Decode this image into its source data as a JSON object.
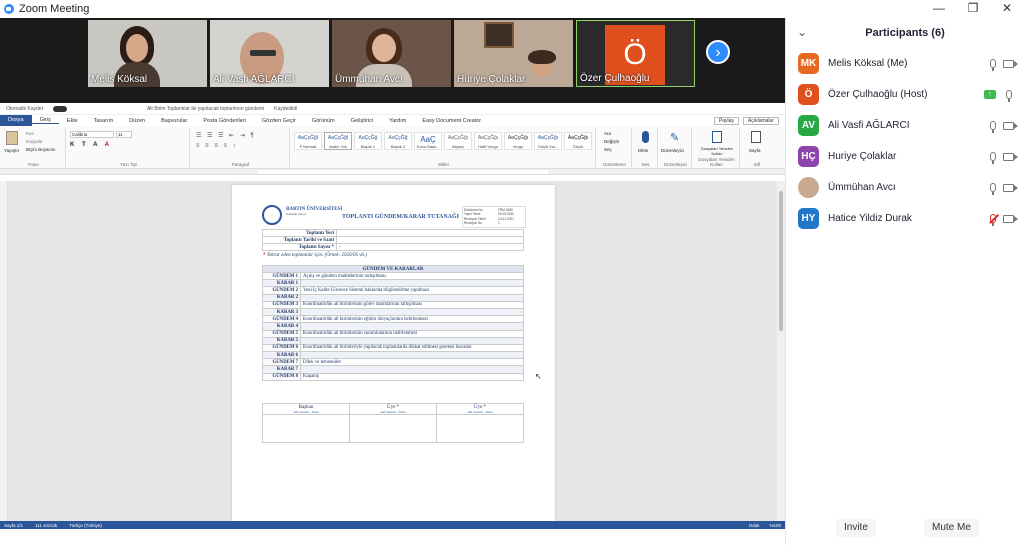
{
  "window": {
    "title": "Zoom Meeting",
    "controls": [
      "—",
      "❐",
      "✕"
    ]
  },
  "gallery": {
    "tiles": [
      {
        "name": "Melis Köksal"
      },
      {
        "name": "Ali Vasfi AĞLARCI"
      },
      {
        "name": "Ümmühan Avcı"
      },
      {
        "name": "Huriye Çolaklar"
      },
      {
        "name": "Özer Çulhaoğlu",
        "avatar_letter": "Ö",
        "avatar_color": "#e0501f"
      }
    ],
    "next_arrow": "›"
  },
  "word": {
    "titlebar": {
      "autosave": "Otomatik Kaydet",
      "filename": "Alt Birim Toplantılar ile yapılacak toplantının gündemi",
      "status": "Kaydedildi"
    },
    "menu": {
      "file": "Dosya",
      "tabs": [
        "Giriş",
        "Ekle",
        "Tasarım",
        "Düzen",
        "Başvurular",
        "Posta Gönderileri",
        "Gözden Geçir",
        "Görünüm",
        "Geliştirici",
        "Yardım",
        "Easy Document Creator"
      ],
      "share": "Paylaş",
      "comments": "Açıklamalar"
    },
    "ribbon": {
      "paste": "Yapıştır",
      "cut": "Kes",
      "copy": "Kopyala",
      "painter": "Biçim Boyacısı",
      "font": "Calibria",
      "size": "11",
      "styles": [
        {
          "sample": "AaÇçĞğI",
          "name": "¶ Normal"
        },
        {
          "sample": "AaÇçĞğI",
          "name": "Aralık Yok"
        },
        {
          "sample": "AaÇçĞğ",
          "name": "Başlık 1"
        },
        {
          "sample": "AaÇçĞğ",
          "name": "Başlık 2"
        },
        {
          "sample": "AaÇ",
          "name": "Konu Başlı..."
        },
        {
          "sample": "AaÇçĞğı",
          "name": "Altyazı"
        },
        {
          "sample": "AaÇçĞğı",
          "name": "Hafif Vurgu"
        },
        {
          "sample": "AaÇçĞğı",
          "name": "Vurgu"
        },
        {
          "sample": "AaÇçĞğı",
          "name": "Güçlü Vur..."
        },
        {
          "sample": "AaÇçĞğı",
          "name": "Güçlü"
        }
      ],
      "find": "Ara",
      "replace": "Değiştir",
      "select": "Seç",
      "dictate": "Dikte",
      "editor": "Düzenleyici",
      "reuse": "Dosyaları Yeniden Kullan",
      "page": "Sayfa",
      "groups": [
        "Pano",
        "Yazı Tipi",
        "Paragraf",
        "Stiller",
        "Düzenleme",
        "Ses",
        "Düzenleyici",
        "Dosyaları Yeniden Kullan",
        "Sıfl"
      ]
    },
    "doc": {
      "university": "BARTIN ÜNİVERSİTESİ",
      "university_sub": "Kalitenin Adresi",
      "title": "TOPLANTI GÜNDEM/KARAR TUTANAĞI",
      "meta": [
        [
          "Doküman No",
          "FRM-0630"
        ],
        [
          "Yayın Tarihi",
          "24.09.2020"
        ],
        [
          "Revizyon Tarihi",
          "13.01.2021"
        ],
        [
          "Revizyon No",
          "1"
        ]
      ],
      "fields": [
        {
          "label": "Toplantı Yeri",
          "value": ""
        },
        {
          "label": "Toplantı Tarihi ve Saati",
          "value": ""
        },
        {
          "label": "Toplantı Sayısı *",
          "value": "-"
        }
      ],
      "note_star": "*",
      "note": "Tekrar eden toplantılar için. (Örnek: 2020/05 vb.)",
      "agenda_header": "GÜNDEM VE KARARLAR",
      "rows": [
        {
          "k": "GÜNDEM 1",
          "v": "Açılış ve gündem maddelerinin tartışılması"
        },
        {
          "k": "KARAR 1",
          "v": ""
        },
        {
          "k": "GÜNDEM 2",
          "v": "Yeni İç Kalite Güvence Sistemi hakkında bilgilendirme yapılması"
        },
        {
          "k": "KARAR 2",
          "v": ""
        },
        {
          "k": "GÜNDEM 3",
          "v": "Koordinatörlük alt birimlerinin görev tanımlarının tartışılması"
        },
        {
          "k": "KARAR 3",
          "v": ""
        },
        {
          "k": "GÜNDEM 4",
          "v": "Koordinatörlük alt birimlerinin eğitim ihtiyaçlarının belirlenmesi"
        },
        {
          "k": "KARAR 4",
          "v": ""
        },
        {
          "k": "GÜNDEM 5",
          "v": "Koordinatörlük alt birimlerinin sorumlularının belirlenmesi"
        },
        {
          "k": "KARAR 5",
          "v": ""
        },
        {
          "k": "GÜNDEM 6",
          "v": "Koordinatörlük alt birimleriyle yapılacak toplantılarda dikkat edilmesi gereken hususlar"
        },
        {
          "k": "KARAR 6",
          "v": ""
        },
        {
          "k": "GÜNDEM 7",
          "v": "Dilek ve temenniler"
        },
        {
          "k": "KARAR 7",
          "v": ""
        },
        {
          "k": "GÜNDEM 8",
          "v": "Kapanış"
        }
      ],
      "signers": [
        {
          "role": "Başkan",
          "sub": "Adı Soyadı - İmza"
        },
        {
          "role": "Üye *",
          "sub": "Adı Soyadı - İmza"
        },
        {
          "role": "Üye *",
          "sub": "Adı Soyadı - İmza"
        }
      ]
    },
    "status": {
      "page": "Sayfa 1/1",
      "words": "111 sözcük",
      "lang": "Türkçe (Türkiye)",
      "focus": "Odak",
      "zoom": "%100"
    }
  },
  "participants": {
    "title": "Participants (6)",
    "list": [
      {
        "initials": "MK",
        "color": "#e8681f",
        "name": "Melis Köksal (Me)",
        "state": "muted-mic"
      },
      {
        "initials": "Ö",
        "color": "#e0501f",
        "name": "Özer Çulhaoğlu (Host)",
        "state": "sharing"
      },
      {
        "initials": "AV",
        "color": "#27a844",
        "name": "Ali Vasfi AĞLARCI",
        "state": "muted-mic"
      },
      {
        "initials": "HÇ",
        "color": "#8e44ad",
        "name": "Huriye Çolaklar",
        "state": "muted-mic"
      },
      {
        "initials": "",
        "color": "#c9a98f",
        "name": "Ümmühan Avcı",
        "state": "muted-mic",
        "photo": true
      },
      {
        "initials": "HY",
        "color": "#2176c8",
        "name": "Hatice Yildiz Durak",
        "state": "mic-off"
      }
    ],
    "invite": "Invite",
    "mute_me": "Mute Me"
  }
}
